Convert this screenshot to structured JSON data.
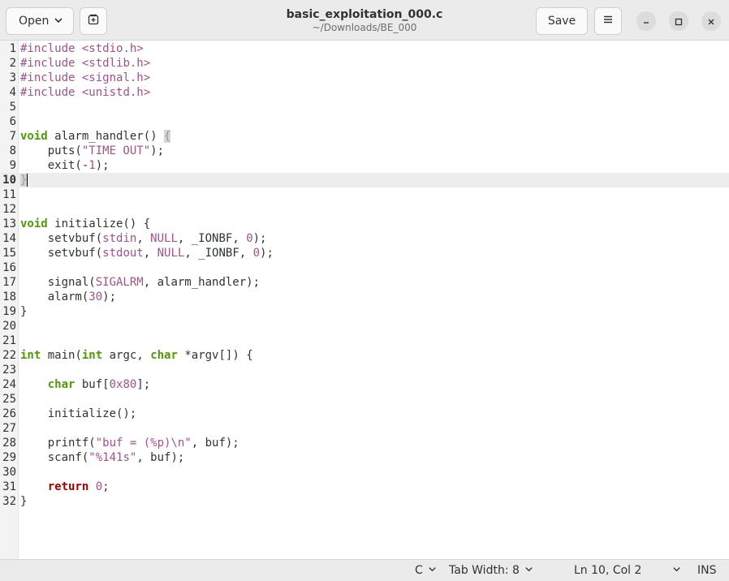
{
  "window": {
    "title": "basic_exploitation_000.c",
    "subtitle": "~/Downloads/BE_000"
  },
  "header": {
    "open_label": "Open",
    "save_label": "Save"
  },
  "icons": {
    "open_chevron": "chevron-down-icon",
    "new_tab": "new-tab-icon",
    "menu": "hamburger-menu-icon",
    "minimize": "minimize-icon",
    "maximize": "maximize-icon",
    "close": "close-icon"
  },
  "editor": {
    "current_line": 10,
    "lines": [
      {
        "n": "1",
        "t": "#include <stdio.h>"
      },
      {
        "n": "2",
        "t": "#include <stdlib.h>"
      },
      {
        "n": "3",
        "t": "#include <signal.h>"
      },
      {
        "n": "4",
        "t": "#include <unistd.h>"
      },
      {
        "n": "5",
        "t": ""
      },
      {
        "n": "6",
        "t": ""
      },
      {
        "n": "7",
        "t": "void alarm_handler() {"
      },
      {
        "n": "8",
        "t": "    puts(\"TIME OUT\");"
      },
      {
        "n": "9",
        "t": "    exit(-1);"
      },
      {
        "n": "10",
        "t": "}"
      },
      {
        "n": "11",
        "t": ""
      },
      {
        "n": "12",
        "t": ""
      },
      {
        "n": "13",
        "t": "void initialize() {"
      },
      {
        "n": "14",
        "t": "    setvbuf(stdin, NULL, _IONBF, 0);"
      },
      {
        "n": "15",
        "t": "    setvbuf(stdout, NULL, _IONBF, 0);"
      },
      {
        "n": "16",
        "t": ""
      },
      {
        "n": "17",
        "t": "    signal(SIGALRM, alarm_handler);"
      },
      {
        "n": "18",
        "t": "    alarm(30);"
      },
      {
        "n": "19",
        "t": "}"
      },
      {
        "n": "20",
        "t": ""
      },
      {
        "n": "21",
        "t": ""
      },
      {
        "n": "22",
        "t": "int main(int argc, char *argv[]) {"
      },
      {
        "n": "23",
        "t": ""
      },
      {
        "n": "24",
        "t": "    char buf[0x80];"
      },
      {
        "n": "25",
        "t": ""
      },
      {
        "n": "26",
        "t": "    initialize();"
      },
      {
        "n": "27",
        "t": ""
      },
      {
        "n": "28",
        "t": "    printf(\"buf = (%p)\\n\", buf);"
      },
      {
        "n": "29",
        "t": "    scanf(\"%141s\", buf);"
      },
      {
        "n": "30",
        "t": ""
      },
      {
        "n": "31",
        "t": "    return 0;"
      },
      {
        "n": "32",
        "t": "}"
      }
    ]
  },
  "statusbar": {
    "language": "C",
    "tab_width": "Tab Width: 8",
    "position": "Ln 10, Col 2",
    "mode": "INS"
  },
  "colors": {
    "string_literal": "#a4508b",
    "type_keyword": "#4e9a06",
    "return_keyword": "#a40000",
    "accent_strip": "#7a2a55"
  }
}
